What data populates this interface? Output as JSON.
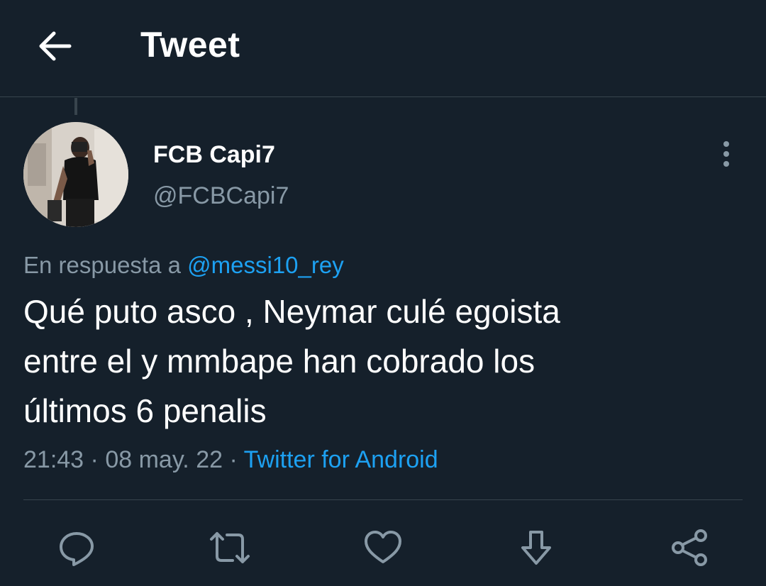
{
  "header": {
    "back_icon": "arrow-left-icon",
    "title": "Tweet"
  },
  "tweet": {
    "author": {
      "name": "FCB Capi7",
      "handle": "@FCBCapi7",
      "avatar": "avatar-photo"
    },
    "more_icon": "more-vertical-icon",
    "reply_prefix": "En respuesta a",
    "reply_to": "@messi10_rey",
    "text": "Qué puto asco , Neymar culé egoista\nentre el y mmbape han cobrado los\núltimos 6 penalis",
    "time": "21:43",
    "separator": "·",
    "date": "08 may. 22",
    "source": "Twitter for Android"
  },
  "actions": [
    {
      "name": "reply",
      "icon": "reply-icon"
    },
    {
      "name": "retweet",
      "icon": "retweet-icon"
    },
    {
      "name": "like",
      "icon": "heart-icon"
    },
    {
      "name": "bookmark",
      "icon": "download-arrow-icon"
    },
    {
      "name": "share",
      "icon": "share-icon"
    }
  ],
  "colors": {
    "background": "#15202b",
    "divider": "#38444d",
    "text_primary": "#ffffff",
    "text_secondary": "#8899a6",
    "link": "#1da1f2"
  }
}
